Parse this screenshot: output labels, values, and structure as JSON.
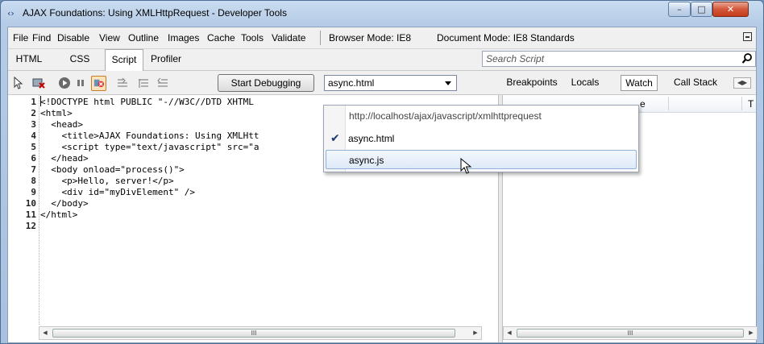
{
  "window": {
    "title": "AJAX Foundations: Using XMLHttpRequest - Developer Tools",
    "controls": [
      "minimize",
      "maximize",
      "close"
    ]
  },
  "menubar": {
    "items": [
      "File",
      "Find",
      "Disable",
      "View",
      "Outline",
      "Images",
      "Cache",
      "Tools",
      "Validate"
    ],
    "browser_mode": "Browser Mode: IE8",
    "document_mode": "Document Mode: IE8 Standards"
  },
  "tabs": [
    {
      "label": "HTML",
      "active": false
    },
    {
      "label": "CSS",
      "active": false
    },
    {
      "label": "Script",
      "active": true
    },
    {
      "label": "Profiler",
      "active": false
    }
  ],
  "search": {
    "placeholder": "Search Script"
  },
  "toolbar": {
    "start_debugging_label": "Start Debugging",
    "file_select_value": "async.html",
    "right_tabs": [
      {
        "label": "Breakpoints",
        "active": false
      },
      {
        "label": "Locals",
        "active": false
      },
      {
        "label": "Watch",
        "active": true
      },
      {
        "label": "Call Stack",
        "active": false
      }
    ],
    "icons": [
      "select-element-icon",
      "clear-browser-icon",
      "continue-icon",
      "pause-icon",
      "break-on-error-icon",
      "step-into-icon",
      "step-over-icon",
      "step-out-icon",
      "scroll-tabs-icon"
    ]
  },
  "source": {
    "line_numbers": [
      "1",
      "2",
      "3",
      "4",
      "5",
      "6",
      "7",
      "8",
      "9",
      "10",
      "11",
      "12"
    ],
    "lines": [
      "<!DOCTYPE html PUBLIC \"-//W3C//DTD XHTML",
      "<html>",
      "  <head>",
      "    <title>AJAX Foundations: Using XMLHtt",
      "    <script type=\"text/javascript\" src=\"a",
      "  </head>",
      "  <body onload=\"process()\">",
      "    <p>Hello, server!</p>",
      "    <div id=\"myDivElement\" />",
      "  </body>",
      "</html>",
      ""
    ]
  },
  "right_pane": {
    "column_headers": [
      "e",
      "T"
    ]
  },
  "dropdown": {
    "url": "http://localhost/ajax/javascript/xmlhttprequest",
    "items": [
      {
        "label": "async.html",
        "checked": true,
        "hover": false
      },
      {
        "label": "async.js",
        "checked": false,
        "hover": true
      }
    ]
  },
  "scrollbar_glyph": "III",
  "colors": {
    "accent_orange": "#c77a2a",
    "tag_color": "#8b0000",
    "string_color": "#0000c8",
    "hover_border": "#8fb0d8"
  }
}
